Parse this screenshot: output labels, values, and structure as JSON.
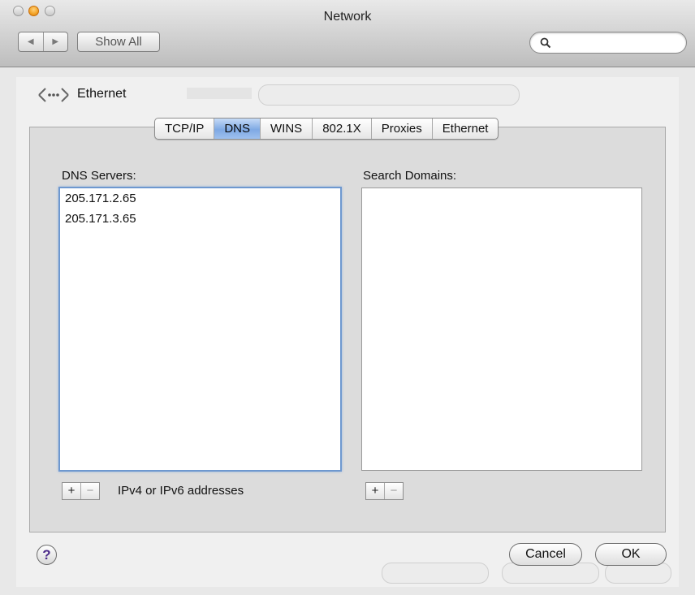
{
  "window": {
    "title": "Network"
  },
  "toolbar": {
    "back_glyph": "◀",
    "forward_glyph": "▶",
    "show_all_label": "Show All",
    "search_placeholder": ""
  },
  "interface": {
    "name": "Ethernet",
    "icon": "ethernet-icon"
  },
  "tabs": [
    {
      "label": "TCP/IP",
      "selected": false
    },
    {
      "label": "DNS",
      "selected": true
    },
    {
      "label": "WINS",
      "selected": false
    },
    {
      "label": "802.1X",
      "selected": false
    },
    {
      "label": "Proxies",
      "selected": false
    },
    {
      "label": "Ethernet",
      "selected": false
    }
  ],
  "dns": {
    "label": "DNS Servers:",
    "servers": [
      "205.171.2.65",
      "205.171.3.65"
    ],
    "hint": "IPv4 or IPv6 addresses",
    "add_glyph": "+",
    "remove_glyph": "−"
  },
  "search_domains": {
    "label": "Search Domains:",
    "items": [],
    "add_glyph": "+",
    "remove_glyph": "−"
  },
  "footer": {
    "help_glyph": "?",
    "cancel_label": "Cancel",
    "ok_label": "OK"
  },
  "colors": {
    "selected_tab": "#7fa9e4",
    "focus_ring": "#6e98cf"
  }
}
